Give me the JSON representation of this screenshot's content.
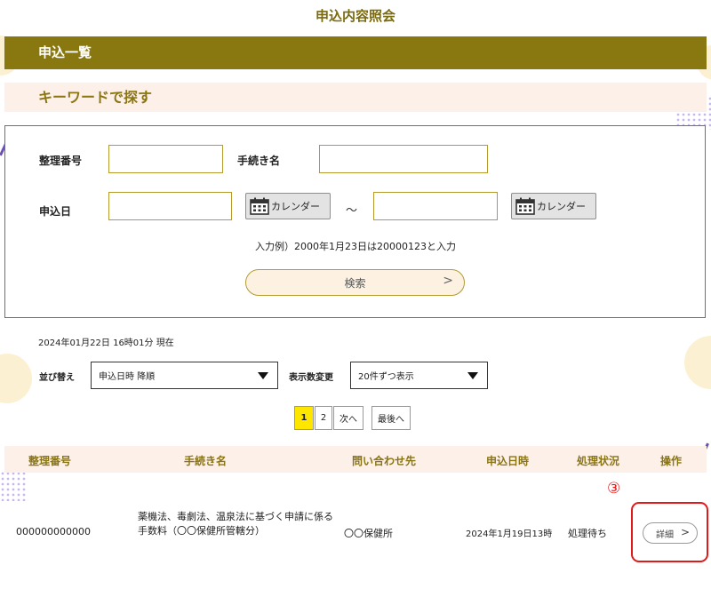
{
  "page_title": "申込内容照会",
  "list_header": "申込一覧",
  "keyword_header": "キーワードで探す",
  "search": {
    "ref_no_label": "整理番号",
    "ref_no_value": "",
    "procedure_label": "手続き名",
    "procedure_value": "",
    "date_label": "申込日",
    "date_from_value": "",
    "date_to_value": "",
    "calendar_label": "カレンダー",
    "range_sep": "～",
    "example": "入力例）2000年1月23日は20000123と入力",
    "button_label": "検索",
    "button_chevron": ">"
  },
  "as_of": "2024年01月22日 16時01分 現在",
  "sort": {
    "label": "並び替え",
    "value": "申込日時 降順"
  },
  "per_page": {
    "label": "表示数変更",
    "value": "20件ずつ表示"
  },
  "pagination": {
    "pages": [
      "1",
      "2"
    ],
    "current": "1",
    "next": "次へ",
    "last": "最後へ"
  },
  "table": {
    "headers": [
      "整理番号",
      "手続き名",
      "問い合わせ先",
      "申込日時",
      "処理状況",
      "操作"
    ],
    "rows": [
      {
        "ref_no": "000000000000",
        "procedure": "薬機法、毒劇法、温泉法に基づく申請に係る手数料（〇〇保健所管轄分）",
        "contact": "〇〇保健所",
        "datetime": "2024年1月19日13時",
        "status": "処理待ち",
        "action": "詳細",
        "action_chevron": ">"
      }
    ]
  },
  "annotation_marker": "③",
  "colors": {
    "brand": "#897710",
    "band_light": "#fdf0e8",
    "highlight": "#e01a1a",
    "current_page": "#ffe600"
  },
  "icons": [
    "calendar-icon",
    "chevron-right-icon",
    "dropdown-arrow-icon"
  ]
}
